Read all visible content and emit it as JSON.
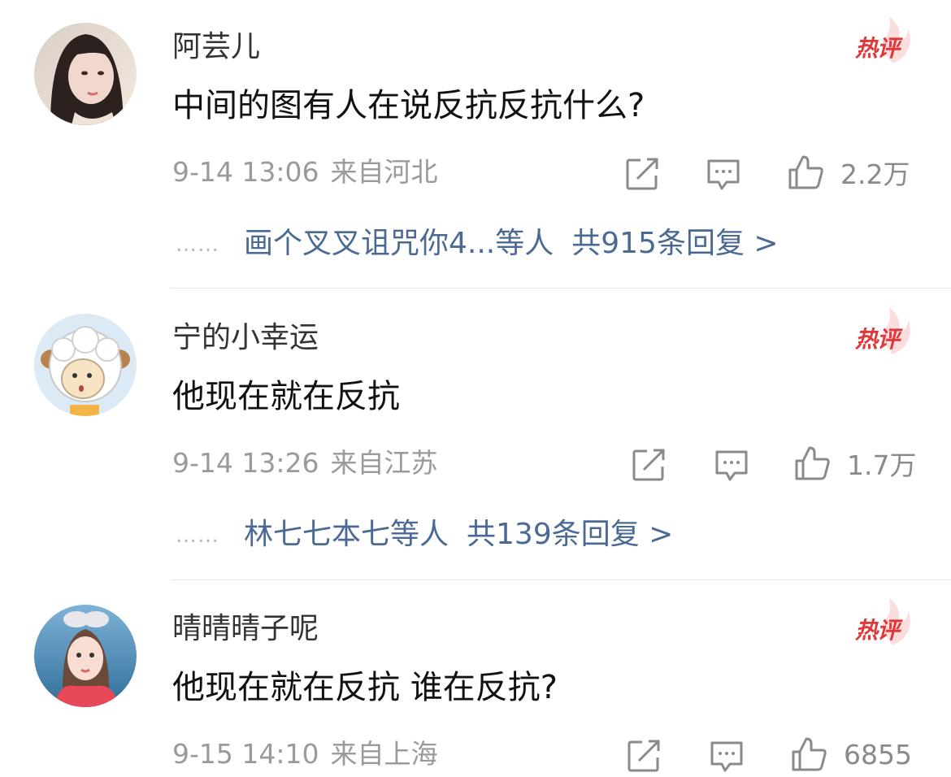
{
  "comments": [
    {
      "username": "阿芸儿",
      "badge": "热评",
      "text": "中间的图有人在说反抗反抗什么?",
      "time": "9-14 13:06",
      "location": "来自河北",
      "likes": "2.2万",
      "reply_dots": "……",
      "reply_names": "画个叉叉诅咒你4...等人",
      "reply_total": "共915条回复 >"
    },
    {
      "username": "宁的小幸运",
      "badge": "热评",
      "text": "他现在就在反抗",
      "time": "9-14 13:26",
      "location": "来自江苏",
      "likes": "1.7万",
      "reply_dots": "……",
      "reply_names": "林七七本七等人",
      "reply_total": "共139条回复 >"
    },
    {
      "username": "晴晴晴子呢",
      "badge": "热评",
      "text": "他现在就在反抗 谁在反抗?",
      "time": "9-15 14:10",
      "location": "来自上海",
      "likes": "6855"
    }
  ],
  "icons": {
    "share": "share-icon",
    "comment": "comment-icon",
    "like": "thumbs-up-icon",
    "badge_flame": "flame-icon"
  },
  "colors": {
    "badge": "#e0373a",
    "link": "#4a6a94",
    "meta": "#9a9a9a"
  }
}
